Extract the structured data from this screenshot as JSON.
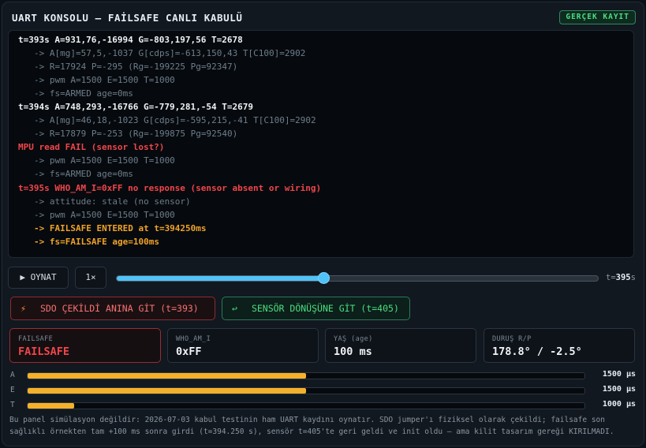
{
  "app": {
    "title": "UART KONSOLU — FAİLSAFE CANLI KABULÜ",
    "badge": "GERÇEK KAYIT"
  },
  "console": {
    "lines": [
      {
        "type": "main",
        "text": "t=393s A=931,76,-16994 G=-803,197,56 T=2678"
      },
      {
        "type": "sub",
        "text": "-> A[mg]=57,5,-1037 G[cdps]=-613,150,43 T[C100]=2902"
      },
      {
        "type": "sub",
        "text": "-> R=17924 P=-295 (Rg=-199225 Pg=92347)"
      },
      {
        "type": "sub",
        "text": "-> pwm A=1500 E=1500 T=1000"
      },
      {
        "type": "sub",
        "text": "-> fs=ARMED age=0ms"
      },
      {
        "type": "main",
        "text": "t=394s A=748,293,-16766 G=-779,281,-54 T=2679"
      },
      {
        "type": "sub",
        "text": "-> A[mg]=46,18,-1023 G[cdps]=-595,215,-41 T[C100]=2902"
      },
      {
        "type": "sub",
        "text": "-> R=17879 P=-253 (Rg=-199875 Pg=92540)"
      },
      {
        "type": "err",
        "text": "MPU read FAIL (sensor lost?)"
      },
      {
        "type": "sub",
        "text": "-> pwm A=1500 E=1500 T=1000"
      },
      {
        "type": "sub",
        "text": "-> fs=ARMED age=0ms"
      },
      {
        "type": "err",
        "text": "t=395s WHO_AM_I=0xFF no response (sensor absent or wiring)"
      },
      {
        "type": "sub",
        "text": "-> attitude: stale (no sensor)"
      },
      {
        "type": "sub",
        "text": "-> pwm A=1500 E=1500 T=1000"
      },
      {
        "type": "warn",
        "text": "-> FAILSAFE ENTERED at t=394250ms"
      },
      {
        "type": "warn",
        "text": "-> fs=FAILSAFE age=100ms"
      }
    ]
  },
  "controls": {
    "play_label": "OYNAT",
    "play_icon": "play-icon",
    "speed_label": "1×",
    "timeline": {
      "value": 395,
      "fraction": 0.43,
      "unit": "s"
    }
  },
  "jumps": {
    "sdo_label": "SDO ÇEKİLDİ ANINA GİT (t=393)",
    "sdo_icon": "lightning-icon",
    "sensor_label": "SENSÖR DÖNÜŞÜNE GİT (t=405)",
    "sensor_icon": "return-arrow-icon"
  },
  "status_cards": [
    {
      "label": "FAILSAFE",
      "value": "FAILSAFE",
      "alert": true
    },
    {
      "label": "WHO_AM_I",
      "value": "0xFF",
      "alert": false
    },
    {
      "label": "YAŞ (age)",
      "value": "100 ms",
      "alert": false
    },
    {
      "label": "DURUŞ R/P",
      "value": "178.8° / -2.5°",
      "alert": false
    }
  ],
  "pwm": [
    {
      "label": "A",
      "value": "1500 µs",
      "fraction": 0.5
    },
    {
      "label": "E",
      "value": "1500 µs",
      "fraction": 0.5
    },
    {
      "label": "T",
      "value": "1000 µs",
      "fraction": 0.0835
    }
  ],
  "colors": {
    "accent": "#4fc3f7",
    "error": "#f0454a",
    "warning": "#f0a229",
    "ok": "#4ade80",
    "bar": "#f5b12a"
  },
  "footnote": "Bu panel simülasyon değildir: 2026-07-03 kabul testinin ham UART kaydını oynatır. SDO jumper'ı fiziksel olarak çekildi; failsafe son sağlıklı örnekten tam +100 ms sonra girdi (t=394.250 s), sensör t=405'te geri geldi ve init oldu — ama kilit tasarım gereği KIRILMADI."
}
